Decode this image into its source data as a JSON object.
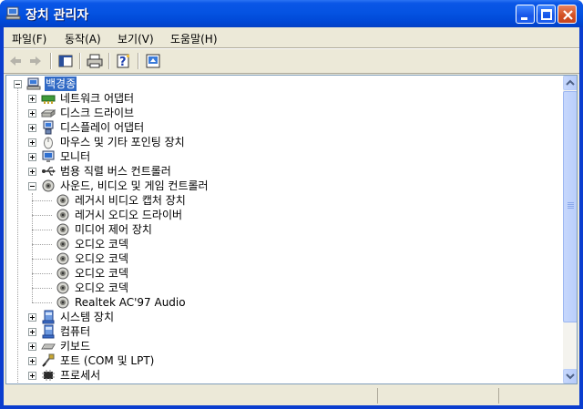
{
  "window": {
    "title": "장치 관리자",
    "icon": "computer-monitor-icon"
  },
  "menu": [
    {
      "label": "파일(F)"
    },
    {
      "label": "동작(A)"
    },
    {
      "label": "보기(V)"
    },
    {
      "label": "도움말(H)"
    }
  ],
  "toolbar": {
    "buttons": [
      "back-arrow-icon",
      "forward-arrow-icon",
      "show-hide-tree-icon",
      "print-icon",
      "help-icon",
      "properties-icon"
    ]
  },
  "tree": {
    "root": {
      "label": "백경종",
      "icon": "computer-icon",
      "expanded": true,
      "selected": true
    },
    "items": [
      {
        "label": "네트워크 어댑터",
        "icon": "network-adapter-icon",
        "expanded": false
      },
      {
        "label": "디스크 드라이브",
        "icon": "disk-drive-icon",
        "expanded": false
      },
      {
        "label": "디스플레이 어댑터",
        "icon": "display-adapter-icon",
        "expanded": false
      },
      {
        "label": "마우스 및 기타 포인팅 장치",
        "icon": "mouse-icon",
        "expanded": false
      },
      {
        "label": "모니터",
        "icon": "monitor-icon",
        "expanded": false
      },
      {
        "label": "범용 직렬 버스 컨트롤러",
        "icon": "usb-icon",
        "expanded": false
      },
      {
        "label": "사운드, 비디오 및 게임 컨트롤러",
        "icon": "sound-icon",
        "expanded": true,
        "children": [
          {
            "label": "레거시 비디오 캡처 장치",
            "icon": "sound-device-icon"
          },
          {
            "label": "레거시 오디오 드라이버",
            "icon": "sound-device-icon"
          },
          {
            "label": "미디어 제어 장치",
            "icon": "sound-device-icon"
          },
          {
            "label": "오디오 코덱",
            "icon": "sound-device-icon"
          },
          {
            "label": "오디오 코덱",
            "icon": "sound-device-icon"
          },
          {
            "label": "오디오 코덱",
            "icon": "sound-device-icon"
          },
          {
            "label": "오디오 코덱",
            "icon": "sound-device-icon"
          },
          {
            "label": "Realtek AC'97 Audio",
            "icon": "sound-device-icon"
          }
        ]
      },
      {
        "label": "시스템 장치",
        "icon": "system-device-icon",
        "expanded": false
      },
      {
        "label": "컴퓨터",
        "icon": "computer-device-icon",
        "expanded": false
      },
      {
        "label": "키보드",
        "icon": "keyboard-icon",
        "expanded": false
      },
      {
        "label": "포트 (COM 및 LPT)",
        "icon": "port-icon",
        "expanded": false
      },
      {
        "label": "프로세서",
        "icon": "processor-icon",
        "expanded": false
      }
    ]
  },
  "scrollbar": {
    "position": 0,
    "visible_fraction": 0.82
  }
}
